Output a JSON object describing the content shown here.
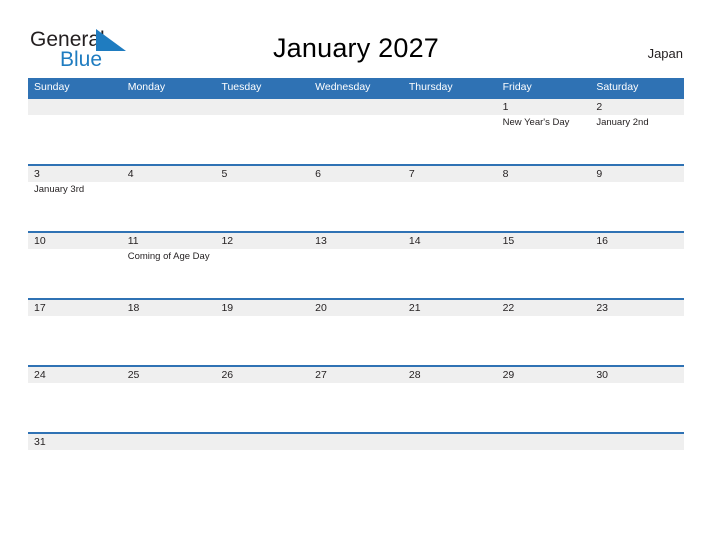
{
  "brand": {
    "word_one": "General",
    "word_two": "Blue",
    "sail_icon": "sail-triangle-icon",
    "color_dark": "#231f20",
    "color_blue": "#1f7cc0"
  },
  "header": {
    "title": "January 2027",
    "region": "Japan"
  },
  "theme": {
    "header_blue": "#2f72b4",
    "row_rule_blue": "#2f72b4",
    "number_band_gray": "#efefef",
    "text_dark": "#231f20",
    "page_background": "#ffffff"
  },
  "calendar": {
    "day_headers": [
      "Sunday",
      "Monday",
      "Tuesday",
      "Wednesday",
      "Thursday",
      "Friday",
      "Saturday"
    ],
    "weeks": [
      {
        "days": [
          {
            "number": "",
            "event": ""
          },
          {
            "number": "",
            "event": ""
          },
          {
            "number": "",
            "event": ""
          },
          {
            "number": "",
            "event": ""
          },
          {
            "number": "",
            "event": ""
          },
          {
            "number": "1",
            "event": "New Year's Day"
          },
          {
            "number": "2",
            "event": "January 2nd"
          }
        ]
      },
      {
        "days": [
          {
            "number": "3",
            "event": "January 3rd"
          },
          {
            "number": "4",
            "event": ""
          },
          {
            "number": "5",
            "event": ""
          },
          {
            "number": "6",
            "event": ""
          },
          {
            "number": "7",
            "event": ""
          },
          {
            "number": "8",
            "event": ""
          },
          {
            "number": "9",
            "event": ""
          }
        ]
      },
      {
        "days": [
          {
            "number": "10",
            "event": ""
          },
          {
            "number": "11",
            "event": "Coming of Age Day"
          },
          {
            "number": "12",
            "event": ""
          },
          {
            "number": "13",
            "event": ""
          },
          {
            "number": "14",
            "event": ""
          },
          {
            "number": "15",
            "event": ""
          },
          {
            "number": "16",
            "event": ""
          }
        ]
      },
      {
        "days": [
          {
            "number": "17",
            "event": ""
          },
          {
            "number": "18",
            "event": ""
          },
          {
            "number": "19",
            "event": ""
          },
          {
            "number": "20",
            "event": ""
          },
          {
            "number": "21",
            "event": ""
          },
          {
            "number": "22",
            "event": ""
          },
          {
            "number": "23",
            "event": ""
          }
        ]
      },
      {
        "days": [
          {
            "number": "24",
            "event": ""
          },
          {
            "number": "25",
            "event": ""
          },
          {
            "number": "26",
            "event": ""
          },
          {
            "number": "27",
            "event": ""
          },
          {
            "number": "28",
            "event": ""
          },
          {
            "number": "29",
            "event": ""
          },
          {
            "number": "30",
            "event": ""
          }
        ]
      },
      {
        "days": [
          {
            "number": "31",
            "event": ""
          },
          {
            "number": "",
            "event": ""
          },
          {
            "number": "",
            "event": ""
          },
          {
            "number": "",
            "event": ""
          },
          {
            "number": "",
            "event": ""
          },
          {
            "number": "",
            "event": ""
          },
          {
            "number": "",
            "event": ""
          }
        ]
      }
    ]
  }
}
